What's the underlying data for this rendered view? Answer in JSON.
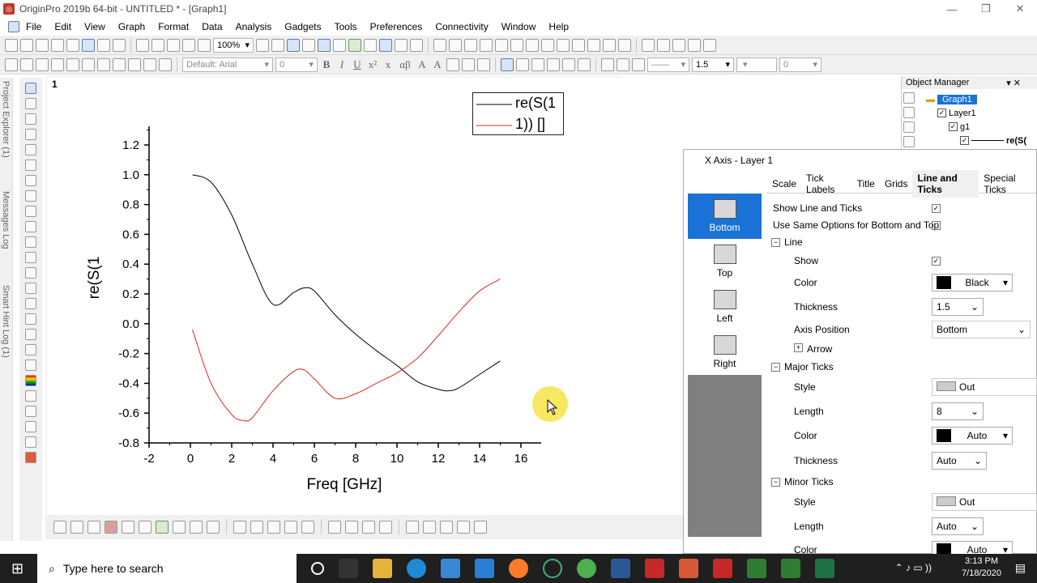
{
  "window": {
    "title": "OriginPro 2019b 64-bit - UNTITLED * - [Graph1]",
    "min": "—",
    "restore": "❐",
    "close": "✕"
  },
  "menu": [
    "File",
    "Edit",
    "View",
    "Graph",
    "Format",
    "Data",
    "Analysis",
    "Gadgets",
    "Tools",
    "Preferences",
    "Connectivity",
    "Window",
    "Help"
  ],
  "toolbar": {
    "zoom": "100%",
    "font": "Default: Arial",
    "size": "0",
    "fmt": [
      "B",
      "I",
      "U",
      "x²",
      "x",
      "αβ",
      "A",
      "A"
    ],
    "line_width": "1.5",
    "pattern_size": "0"
  },
  "side_tabs": [
    "Project Explorer (1)",
    "Messages Log",
    "Smart Hint Log (1)"
  ],
  "page_number": "1",
  "chart_data": {
    "type": "line",
    "xlabel": "Freq [GHz]",
    "ylabel": "re(S(1",
    "xlim": [
      -2,
      17
    ],
    "ylim": [
      -0.8,
      1.3
    ],
    "xticks": [
      "-2",
      "0",
      "2",
      "4",
      "6",
      "8",
      "10",
      "12",
      "14",
      "16"
    ],
    "yticks": [
      "-0.8",
      "-0.6",
      "-0.4",
      "-0.2",
      "0.0",
      "0.2",
      "0.4",
      "0.6",
      "0.8",
      "1.0",
      "1.2"
    ],
    "legend": [
      "re(S(1",
      "1)) []"
    ],
    "series": [
      {
        "color": "#000000",
        "x": [
          0.1,
          1,
          2,
          3,
          4,
          5,
          5.5,
          6,
          7,
          8,
          9,
          10,
          11,
          12,
          12.5,
          13,
          14,
          15
        ],
        "y": [
          1.0,
          0.95,
          0.73,
          0.4,
          0.13,
          0.21,
          0.24,
          0.22,
          0.06,
          -0.07,
          -0.18,
          -0.28,
          -0.39,
          -0.44,
          -0.45,
          -0.43,
          -0.34,
          -0.25
        ]
      },
      {
        "color": "#d42a1e",
        "x": [
          0.1,
          1,
          2,
          2.6,
          3,
          4,
          5,
          5.5,
          6,
          7,
          8,
          9,
          10,
          11,
          12,
          13,
          14,
          15
        ],
        "y": [
          -0.04,
          -0.4,
          -0.61,
          -0.65,
          -0.63,
          -0.45,
          -0.32,
          -0.31,
          -0.37,
          -0.5,
          -0.47,
          -0.4,
          -0.33,
          -0.23,
          -0.08,
          0.08,
          0.22,
          0.3
        ]
      }
    ]
  },
  "object_manager": {
    "title": "Object Manager",
    "items": [
      "Graph1",
      "Layer1",
      "g1",
      "re(S("
    ]
  },
  "dialog": {
    "title": "X Axis - Layer 1",
    "tabs": [
      "Scale",
      "Tick Labels",
      "Title",
      "Grids",
      "Line and Ticks",
      "Special Ticks"
    ],
    "sides": [
      "Bottom",
      "Top",
      "Left",
      "Right"
    ],
    "show_line_ticks": "Show Line and Ticks",
    "same_options": "Use Same Options for Bottom and Top",
    "line_section": "Line",
    "show": "Show",
    "color": "Color",
    "color_val": "Black",
    "thickness": "Thickness",
    "thickness_val": "1.5",
    "axis_position": "Axis Position",
    "axis_position_val": "Bottom",
    "arrow": "Arrow",
    "major_section": "Major Ticks",
    "style": "Style",
    "style_val": "Out",
    "length": "Length",
    "major_length": "8",
    "auto": "Auto",
    "minor_section": "Minor Ticks",
    "minor_style_val": "Out",
    "minor_length": "Auto",
    "minor_color": "Auto"
  },
  "taskbar": {
    "search": "Type here to search",
    "time": "3:13 PM",
    "date": "7/18/2020"
  }
}
